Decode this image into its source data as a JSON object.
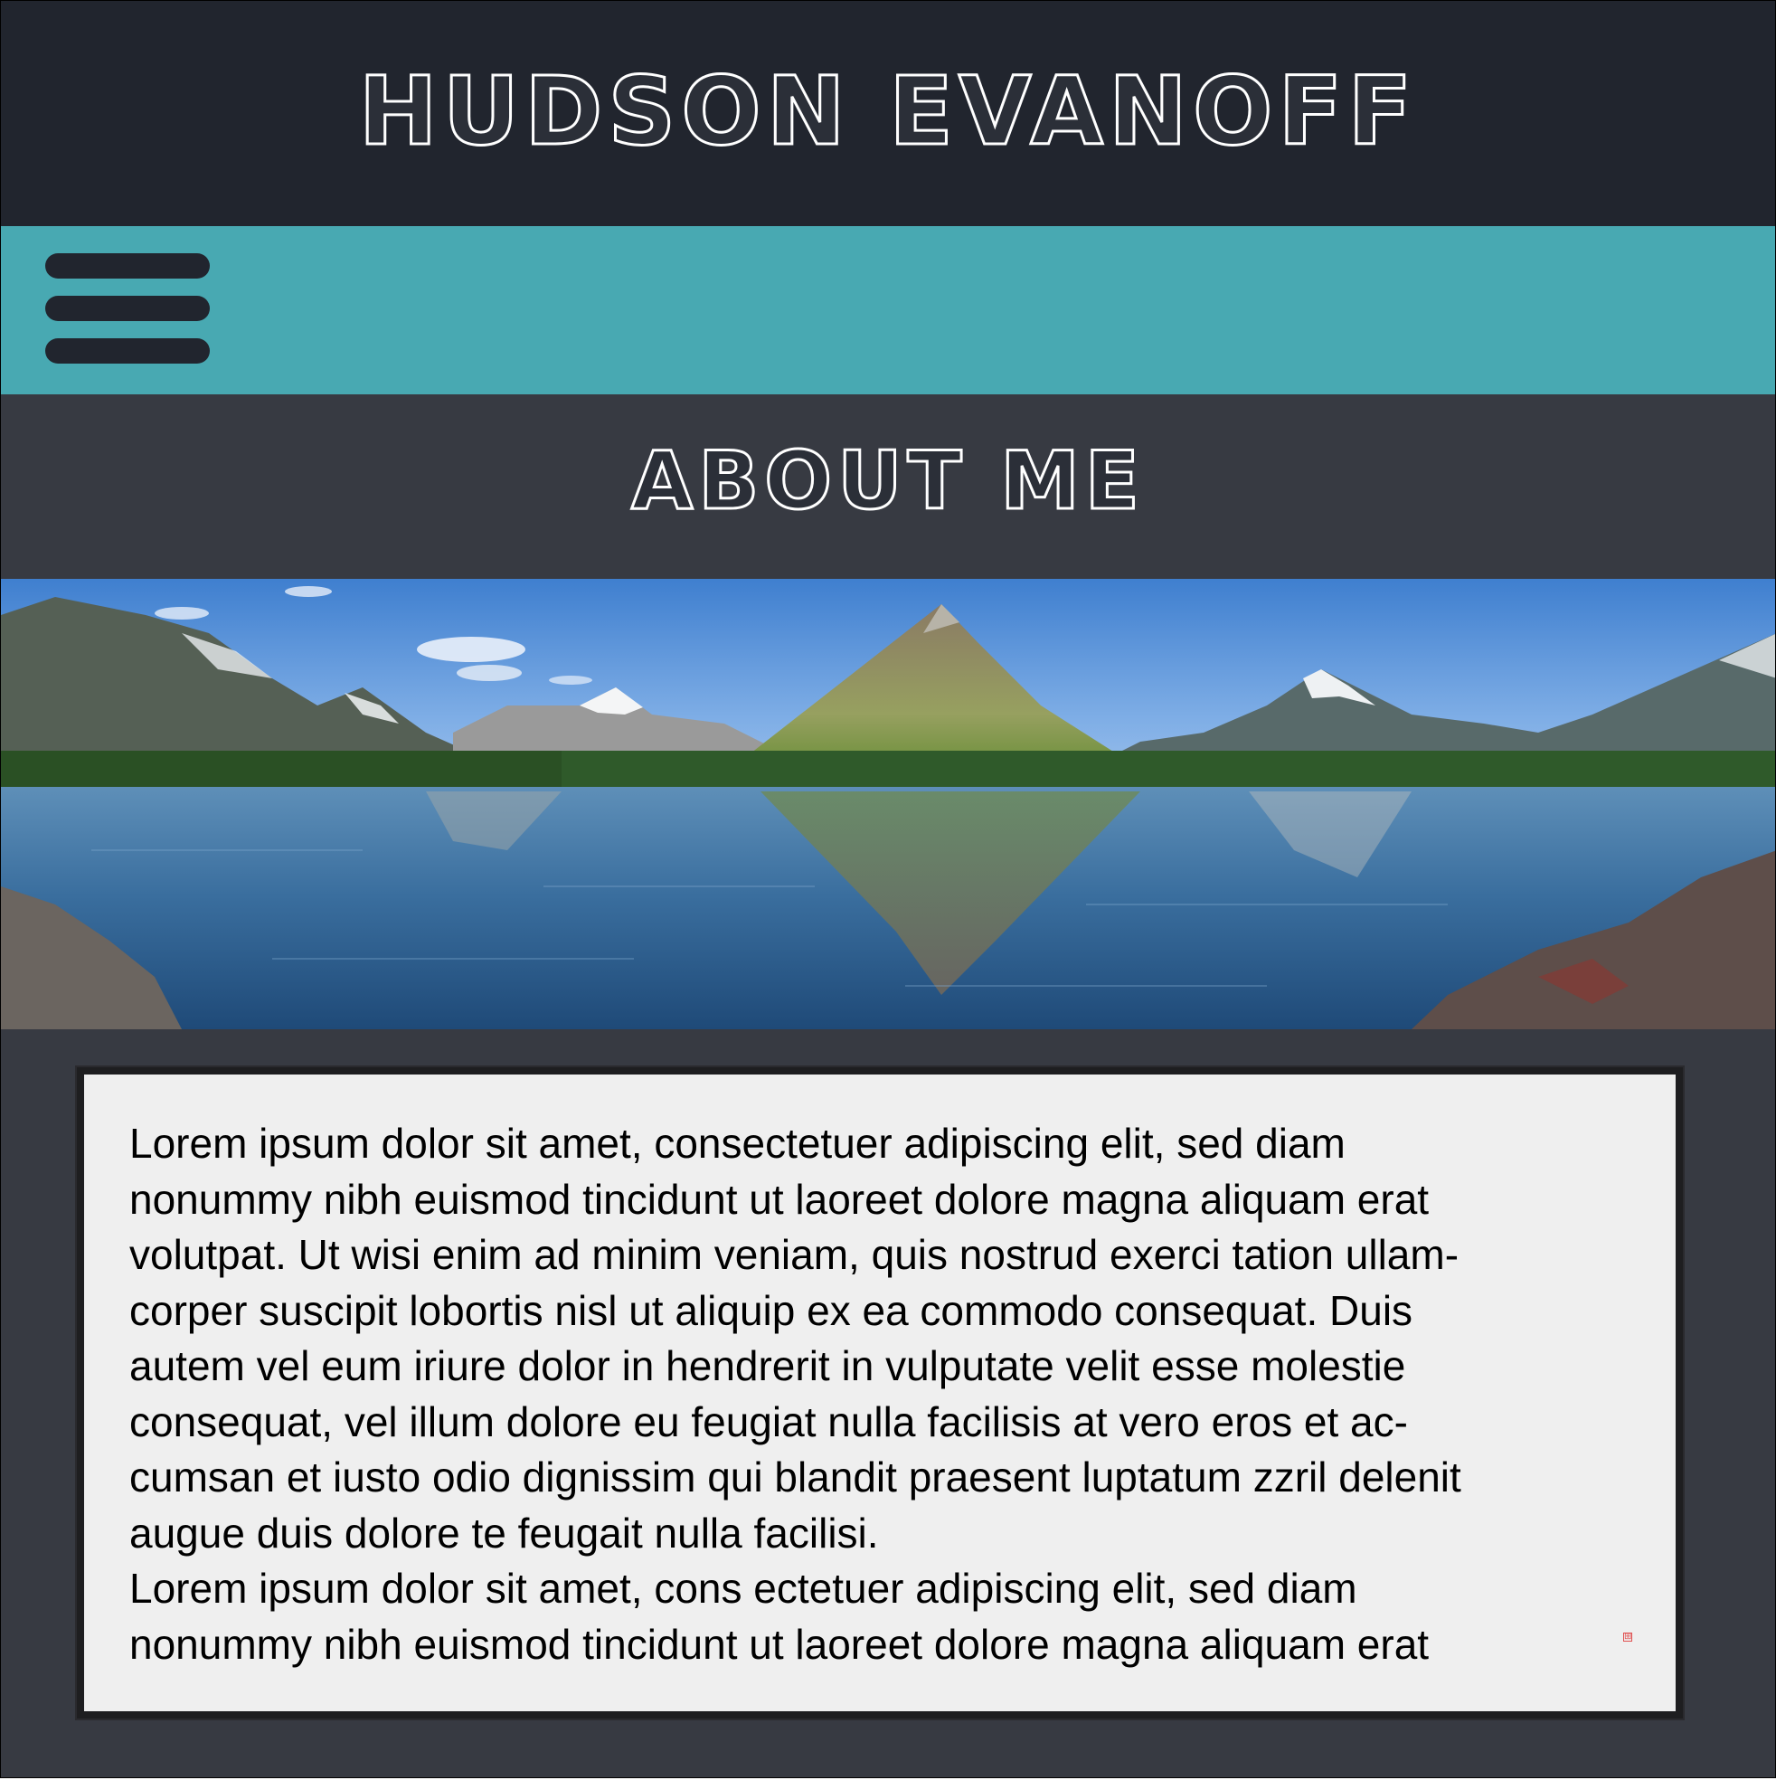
{
  "header": {
    "title": "HUDSON EVANOFF",
    "background_color": "#21252e"
  },
  "nav": {
    "menu_icon": "hamburger-menu-icon",
    "background_color": "#48a9b2"
  },
  "section": {
    "heading": "ABOUT ME",
    "background_color": "#373a42"
  },
  "hero": {
    "image_description_icon": "mountain-lake-landscape-image"
  },
  "content": {
    "paragraph_lines": [
      "Lorem ipsum dolor sit amet, consectetuer adipiscing elit, sed diam",
      "nonummy nibh euismod tincidunt ut laoreet dolore magna aliquam erat",
      "volutpat. Ut wisi enim ad minim veniam, quis nostrud exerci tation ullam-",
      "corper suscipit lobortis nisl ut aliquip ex ea commodo consequat. Duis",
      "autem vel eum iriure dolor in hendrerit in vulputate velit esse molestie",
      "consequat, vel illum dolore eu feugiat nulla facilisis at vero eros et ac-",
      "cumsan et iusto odio dignissim qui blandit praesent luptatum zzril delenit",
      "augue duis dolore te feugait nulla facilisi.",
      "Lorem ipsum dolor sit amet, cons ectetuer adipiscing elit, sed diam",
      "nonummy nibh euismod tincidunt ut laoreet dolore magna aliquam erat"
    ],
    "overflow_marker": "⊞",
    "background_color": "#efefef"
  }
}
